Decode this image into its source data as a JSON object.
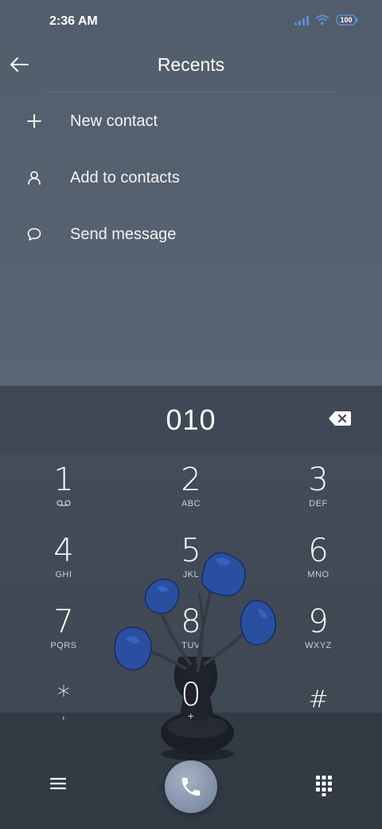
{
  "status_bar": {
    "time": "2:36 AM",
    "battery": "100",
    "icons": [
      "signal-icon",
      "wifi-icon",
      "battery-icon"
    ]
  },
  "header": {
    "title": "Recents",
    "back_icon": "arrow-left-icon"
  },
  "menu": [
    {
      "label": "New contact",
      "icon": "plus-icon"
    },
    {
      "label": "Add to contacts",
      "icon": "person-icon"
    },
    {
      "label": "Send message",
      "icon": "message-bubble-icon"
    }
  ],
  "dialer": {
    "number": "010",
    "backspace_icon": "backspace-icon",
    "keys": [
      {
        "digit": "1",
        "letters": ""
      },
      {
        "digit": "2",
        "letters": "ABC"
      },
      {
        "digit": "3",
        "letters": "DEF"
      },
      {
        "digit": "4",
        "letters": "GHI"
      },
      {
        "digit": "5",
        "letters": "JKL"
      },
      {
        "digit": "6",
        "letters": "MNO"
      },
      {
        "digit": "7",
        "letters": "PQRS"
      },
      {
        "digit": "8",
        "letters": "TUV"
      },
      {
        "digit": "9",
        "letters": "WXYZ"
      },
      {
        "digit": "*",
        "letters": ","
      },
      {
        "digit": "0",
        "letters": "+"
      },
      {
        "digit": "#",
        "letters": ""
      }
    ]
  },
  "bottom_bar": {
    "menu_icon": "hamburger-menu-icon",
    "call_icon": "phone-icon",
    "dialpad_icon": "dialpad-grid-icon"
  },
  "colors": {
    "background_top": "#56616f",
    "background_dialpad": "#424b57",
    "call_button": "#8693aa",
    "signal_accent": "#5b8fd8"
  }
}
